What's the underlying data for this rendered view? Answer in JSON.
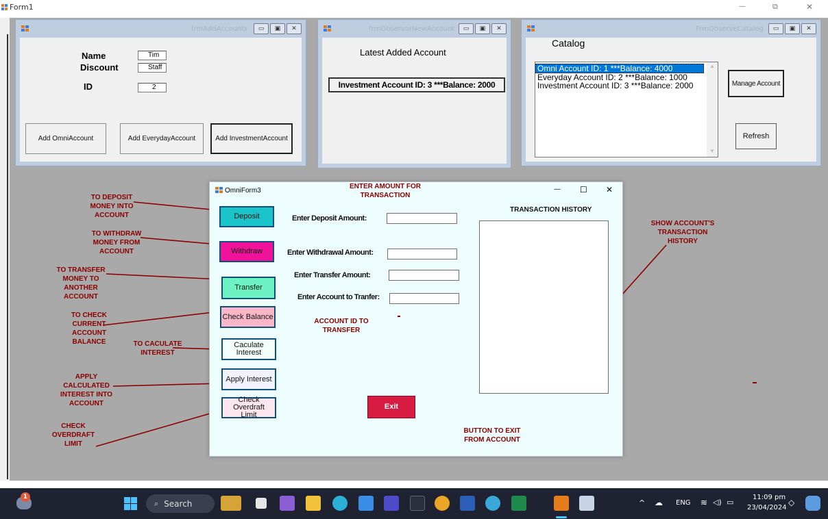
{
  "main_window": {
    "title": "Form1",
    "controls": {
      "minimize": "—",
      "restore": "⧉",
      "close": "✕"
    }
  },
  "add_accounts": {
    "title": "frmAddAccounts",
    "name_label": "Name",
    "name_value": "Tim",
    "discount_label": "Discount",
    "discount_value": "Staff",
    "id_label": "ID",
    "id_value": "2",
    "add_omni": "Add OmniAccount",
    "add_everyday": "Add EverydayAccount",
    "add_investment": "Add InvestmentAccount"
  },
  "observer_new": {
    "title": "frmObservorNewAccount",
    "heading": "Latest Added Account",
    "latest": "Investment Account ID: 3 ***Balance: 2000"
  },
  "observe_catalog": {
    "title": "FrmObserveCatalog",
    "heading": "Catalog",
    "items": [
      "Omni Account ID: 1  ***Balance: 4000",
      "Everyday Account ID: 2  ***Balance: 1000",
      "Investment Account ID: 3  ***Balance: 2000"
    ],
    "manage": "Manage Account",
    "refresh": "Refresh"
  },
  "omni": {
    "title": "OmniForm3",
    "controls": {
      "minimize": "—",
      "maximize": "☐",
      "close": "✕"
    },
    "buttons": {
      "deposit": "Deposit",
      "withdraw": "Withdraw",
      "transfer": "Transfer",
      "check_balance": "Check Balance",
      "calculate_interest": "Caculate Interest",
      "apply_interest": "Apply Interest",
      "check_overdraft": "Check Overdraft Limit",
      "exit": "Exit"
    },
    "labels": {
      "deposit_amount": "Enter Deposit Amount:",
      "withdrawal_amount": "Enter Withdrawal Amount:",
      "transfer_amount": "Enter Transfer Amount:",
      "transfer_account": "Enter Account to Tranfer:",
      "history_title": "TRANSACTION HISTORY"
    },
    "colors": {
      "deposit": "#1bc4c9",
      "withdraw": "#f0129b",
      "transfer": "#6df2c4",
      "check_balance": "#fbb6c7",
      "exit": "#d81c41"
    }
  },
  "annotations": {
    "deposit": "TO DEPOSIT MONEY INTO ACCOUNT",
    "withdraw": "TO WITHDRAW MONEY FROM ACCOUNT",
    "transfer": "TO TRANSFER MONEY TO ANOTHER ACCOUNT",
    "check_balance": "TO CHECK CURRENT ACCOUNT BALANCE",
    "calculate": "TO CACULATE INTEREST",
    "apply": "APPLY CALCULATED INTEREST INTO ACCOUNT",
    "overdraft": "CHECK OVERDRAFT LIMIT",
    "amount": "ENTER AMOUNT FOR TRANSACTION",
    "account_id": "ACCOUNT ID TO TRANSFER",
    "history": "SHOW ACCOUNT'S TRANSACTION HISTORY",
    "exit": "BUTTON TO EXIT FROM ACCOUNT"
  },
  "taskbar": {
    "search": "Search",
    "language": "ENG",
    "time": "11:09 pm",
    "date": "23/04/2024",
    "notification_badge": "1"
  }
}
